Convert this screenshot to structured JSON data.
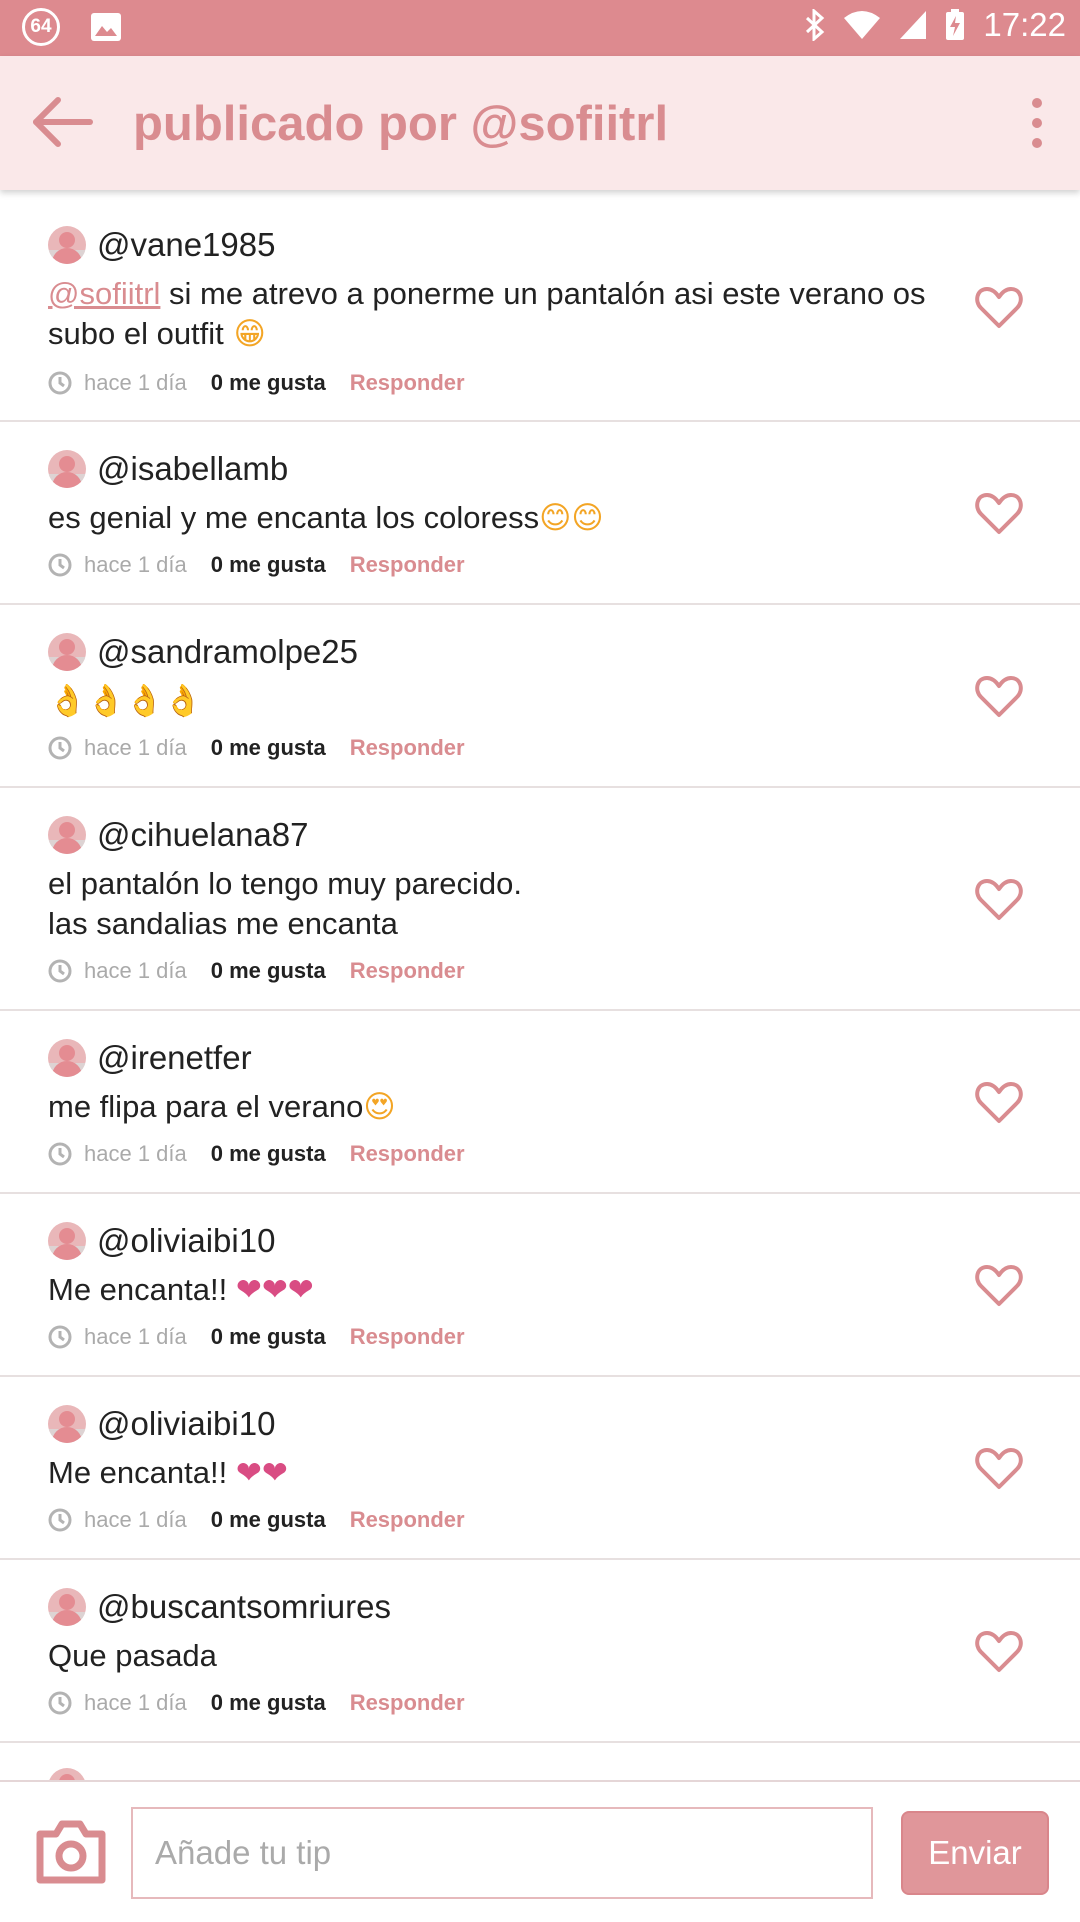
{
  "status_bar": {
    "badge": "64",
    "time": "17:22"
  },
  "app_bar": {
    "title": "publicado por @sofiitrl"
  },
  "comments": [
    {
      "user": "@vane1985",
      "mention": "@sofiitrl",
      "text": " si me atrevo a ponerme un pantalón asi este verano os subo el outfit",
      "emoji": " 😁",
      "time": "hace 1 día",
      "likes": "0 me gusta",
      "reply": "Responder"
    },
    {
      "user": "@isabellamb",
      "text": "es genial y me encanta los coloress",
      "emoji": "😊😊",
      "time": "hace 1 día",
      "likes": "0 me gusta",
      "reply": "Responder"
    },
    {
      "user": "@sandramolpe25",
      "text": "",
      "emoji": " 👌👌👌👌",
      "time": "hace 1 día",
      "likes": "0 me gusta",
      "reply": "Responder"
    },
    {
      "user": "@cihuelana87",
      "text_line1": "el pantalón lo tengo muy parecido.",
      "text_line2": "las sandalias me encanta",
      "time": "hace 1 día",
      "likes": "0 me gusta",
      "reply": "Responder"
    },
    {
      "user": "@irenetfer",
      "text": "me flipa para el verano",
      "emoji": "😍",
      "time": "hace 1 día",
      "likes": "0 me gusta",
      "reply": "Responder"
    },
    {
      "user": "@oliviaibi10",
      "text": "Me encanta!! ",
      "emoji": "❤❤❤",
      "time": "hace 1 día",
      "likes": "0 me gusta",
      "reply": "Responder"
    },
    {
      "user": "@oliviaibi10",
      "text": "Me encanta!! ",
      "emoji": "❤❤",
      "time": "hace 1 día",
      "likes": "0 me gusta",
      "reply": "Responder"
    },
    {
      "user": "@buscantsomriures",
      "text": "Que pasada",
      "time": "hace 1 día",
      "likes": "0 me gusta",
      "reply": "Responder"
    }
  ],
  "composer": {
    "placeholder": "Añade tu tip",
    "send_label": "Enviar"
  },
  "colors": {
    "accent": "#d98c90",
    "status_bar": "#dd8a8f",
    "app_bar": "#fae8e9",
    "send_button": "#e0969a"
  }
}
